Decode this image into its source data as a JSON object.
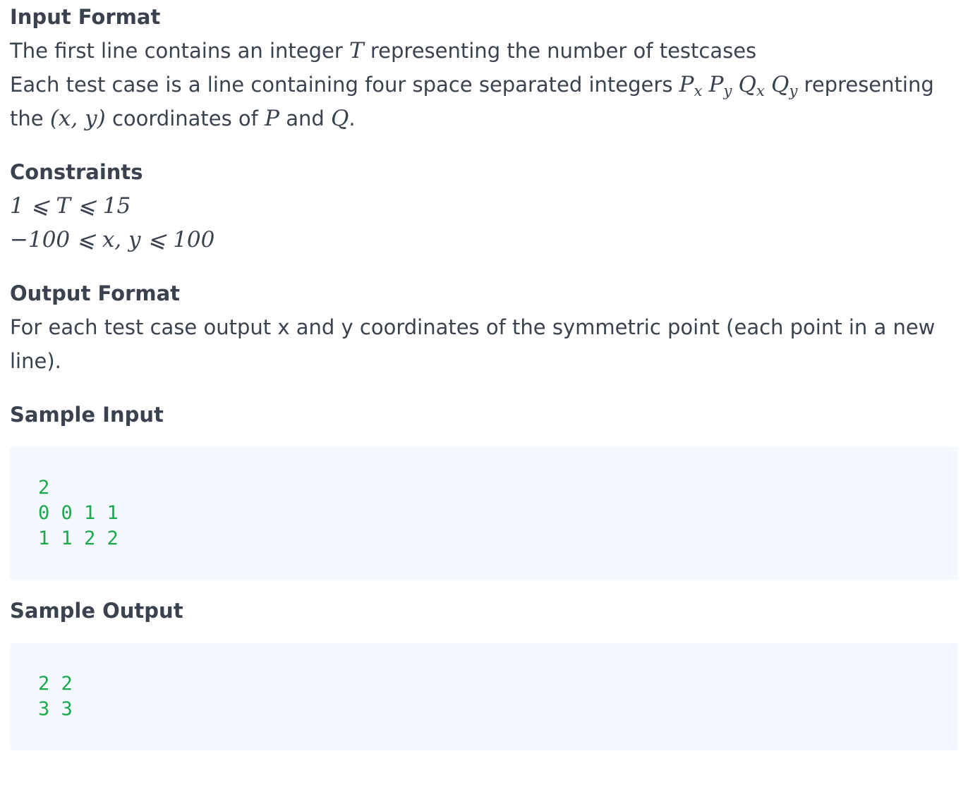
{
  "input_format": {
    "heading": "Input Format",
    "line1_prefix": "The first line contains an integer",
    "line1_var": "T",
    "line1_suffix": "representing the number of testcases",
    "line2_prefix": "Each test case is a line containing four space separated integers",
    "vars": {
      "px_base": "P",
      "px_sub": "x",
      "py_base": "P",
      "py_sub": "y",
      "qx_base": "Q",
      "qx_sub": "x",
      "qy_base": "Q",
      "qy_sub": "y"
    },
    "line2_mid": "representing",
    "line3_prefix": "the",
    "coord_expr": "(x, y)",
    "line3_mid1": "coordinates of",
    "p_var": "P",
    "line3_mid2": "and",
    "q_var": "Q",
    "line3_end": "."
  },
  "constraints": {
    "heading": "Constraints",
    "c1": "1 ⩽ T ⩽ 15",
    "c2": "−100 ⩽ x, y ⩽ 100"
  },
  "output_format": {
    "heading": "Output Format",
    "text": "For each test case output x and y coordinates of the symmetric point (each point in a new line)."
  },
  "sample_input": {
    "heading": "Sample Input",
    "code": "2\n0 0 1 1\n1 1 2 2"
  },
  "sample_output": {
    "heading": "Sample Output",
    "code": "2 2\n3 3"
  },
  "colors": {
    "text": "#39424e",
    "code_bg": "#f3f7fe",
    "code_text": "#1ba94c"
  }
}
